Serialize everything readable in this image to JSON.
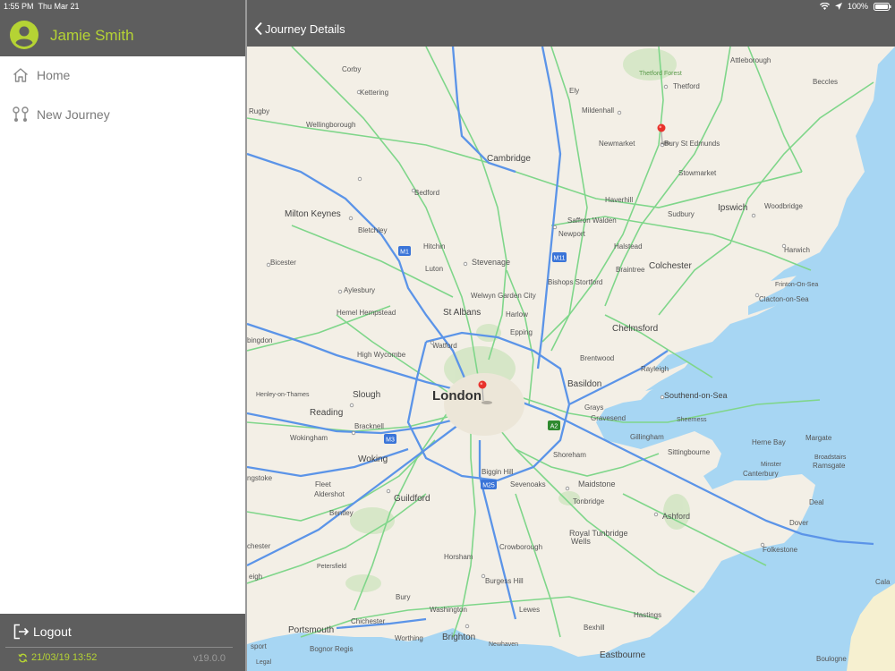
{
  "status_bar": {
    "time": "1:55 PM",
    "date": "Thu Mar 21",
    "battery": "100%"
  },
  "sidebar": {
    "user_name": "Jamie Smith",
    "items": [
      {
        "label": "Home",
        "icon": "home-icon"
      },
      {
        "label": "New Journey",
        "icon": "route-icon"
      }
    ],
    "logout_label": "Logout",
    "sync_time": "21/03/19 13:52",
    "version": "v19.0.0"
  },
  "header": {
    "back_label": "Journey Details"
  },
  "map": {
    "legal": "Legal",
    "labels": {
      "corby": "Corby",
      "kettering": "Kettering",
      "rugby": "Rugby",
      "wellingborough": "Wellingborough",
      "thetford_forest": "Thetford Forest",
      "attleborough": "Attleborough",
      "thetford": "Thetford",
      "beccles": "Beccles",
      "ely": "Ely",
      "mildenhall": "Mildenhall",
      "newmarket": "Newmarket",
      "bury": "Bury St Edmunds",
      "cambridge": "Cambridge",
      "stowmarket": "Stowmarket",
      "bedford": "Bedford",
      "haverhill": "Haverhill",
      "ipswich": "Ipswich",
      "woodbridge": "Woodbridge",
      "milton_keynes": "Milton Keynes",
      "saffron_walden": "Saffron Walden",
      "sudbury": "Sudbury",
      "bletchley": "Bletchley",
      "newport": "Newport",
      "hitchin": "Hitchin",
      "halstead": "Halstead",
      "harwich": "Harwich",
      "bicester": "Bicester",
      "luton": "Luton",
      "stevenage": "Stevenage",
      "braintree": "Braintree",
      "colchester": "Colchester",
      "bishops_stortford": "Bishops Stortford",
      "frinton": "Frinton-On-Sea",
      "aylesbury": "Aylesbury",
      "welwyn": "Welwyn Garden City",
      "clacton": "Clacton-on-Sea",
      "hemel": "Hemel Hempstead",
      "st_albans": "St Albans",
      "harlow": "Harlow",
      "epping": "Epping",
      "chelmsford": "Chelmsford",
      "abingdon": "bingdon",
      "watford": "Watford",
      "high_wycombe": "High Wycombe",
      "brentwood": "Brentwood",
      "rayleigh": "Rayleigh",
      "henley": "Henley-on-Thames",
      "slough": "Slough",
      "london": "London",
      "basildon": "Basildon",
      "southend": "Southend-on-Sea",
      "grays": "Grays",
      "reading": "Reading",
      "gravesend": "Gravesend",
      "sheerness": "Sheerness",
      "bracknell": "Bracknell",
      "wokingham": "Wokingham",
      "gillingham": "Gillingham",
      "herne_bay": "Herne Bay",
      "margate": "Margate",
      "broadstairs": "Broadstairs",
      "ramsgate": "Ramsgate",
      "sittingbourne": "Sittingbourne",
      "minster": "Minster",
      "woking": "Woking",
      "shoreham": "Shoreham",
      "canterbury": "Canterbury",
      "ngstoke": "ngstoke",
      "fleet": "Fleet",
      "biggin_hill": "Biggin Hill",
      "aldershot": "Aldershot",
      "sevenoaks": "Sevenoaks",
      "maidstone": "Maidstone",
      "guildford": "Guildford",
      "tonbridge": "Tonbridge",
      "deal": "Deal",
      "bentley": "Bentley",
      "ashford": "Ashford",
      "dover": "Dover",
      "royal_tunbridge": "Royal Tunbridge",
      "wells": "Wells",
      "chester": "chester",
      "crowborough": "Crowborough",
      "folkestone": "Folkestone",
      "horsham": "Horsham",
      "petersfield": "Petersfield",
      "eigh": "eigh",
      "cala": "Cala",
      "burgess_hill": "Burgess Hill",
      "bury_w": "Bury",
      "washington": "Washington",
      "lewes": "Lewes",
      "hastings": "Hastings",
      "chichester": "Chichester",
      "bexhill": "Bexhill",
      "portsmouth": "Portsmouth",
      "worthing": "Worthing",
      "brighton": "Brighton",
      "sport": "sport",
      "bognor": "Bognor Regis",
      "newhaven": "Newhaven",
      "eastbourne": "Eastbourne",
      "boulogne": "Boulogne"
    },
    "shields": {
      "m1_a": "M1",
      "m11": "M11",
      "m3": "M3",
      "a2": "A2",
      "m25": "M25"
    },
    "colors": {
      "land": "#f3efe6",
      "sea": "#a7d6f3",
      "motorway": "#5b94e8",
      "a_road": "#7fd68a",
      "pin": "#e8322c"
    }
  }
}
